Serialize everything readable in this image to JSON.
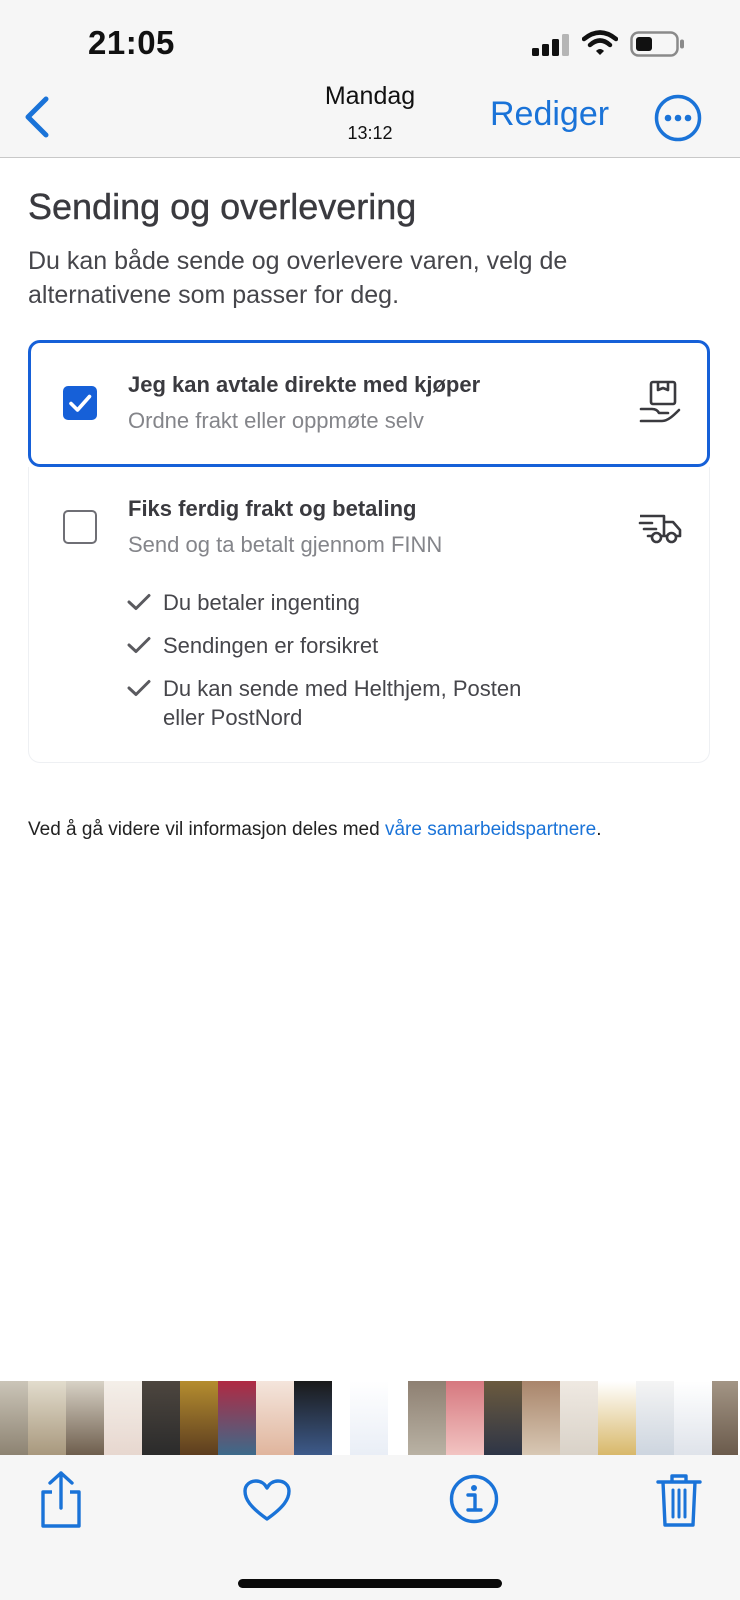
{
  "status_bar": {
    "time": "21:05"
  },
  "nav": {
    "title": "Mandag",
    "subtitle": "13:12",
    "edit_label": "Rediger"
  },
  "page": {
    "heading": "Sending og overlevering",
    "intro": "Du kan både sende og overlevere varen, velg de alternativene som passer for deg."
  },
  "options": [
    {
      "title": "Jeg kan avtale direkte med kjøper",
      "description": "Ordne frakt eller oppmøte selv",
      "checked": true,
      "icon": "package-hand-icon"
    },
    {
      "title": "Fiks ferdig frakt og betaling",
      "description": "Send og ta betalt gjennom FINN",
      "checked": false,
      "icon": "delivery-truck-icon",
      "benefits": [
        "Du betaler ingenting",
        "Sendingen er forsikret",
        "Du kan sende med Helthjem, Posten",
        "eller PostNord"
      ]
    }
  ],
  "footer": {
    "text": "Ved å gå videre vil informasjon deles med ",
    "link": "våre samarbeidspartnere",
    "end": "."
  },
  "colors": {
    "accent": "#1a73d8",
    "selected_border": "#1660d8",
    "bar_background": "#f6f6f6"
  },
  "toolbar": {
    "icons": [
      "share-icon",
      "heart-icon",
      "info-icon",
      "trash-icon"
    ]
  }
}
